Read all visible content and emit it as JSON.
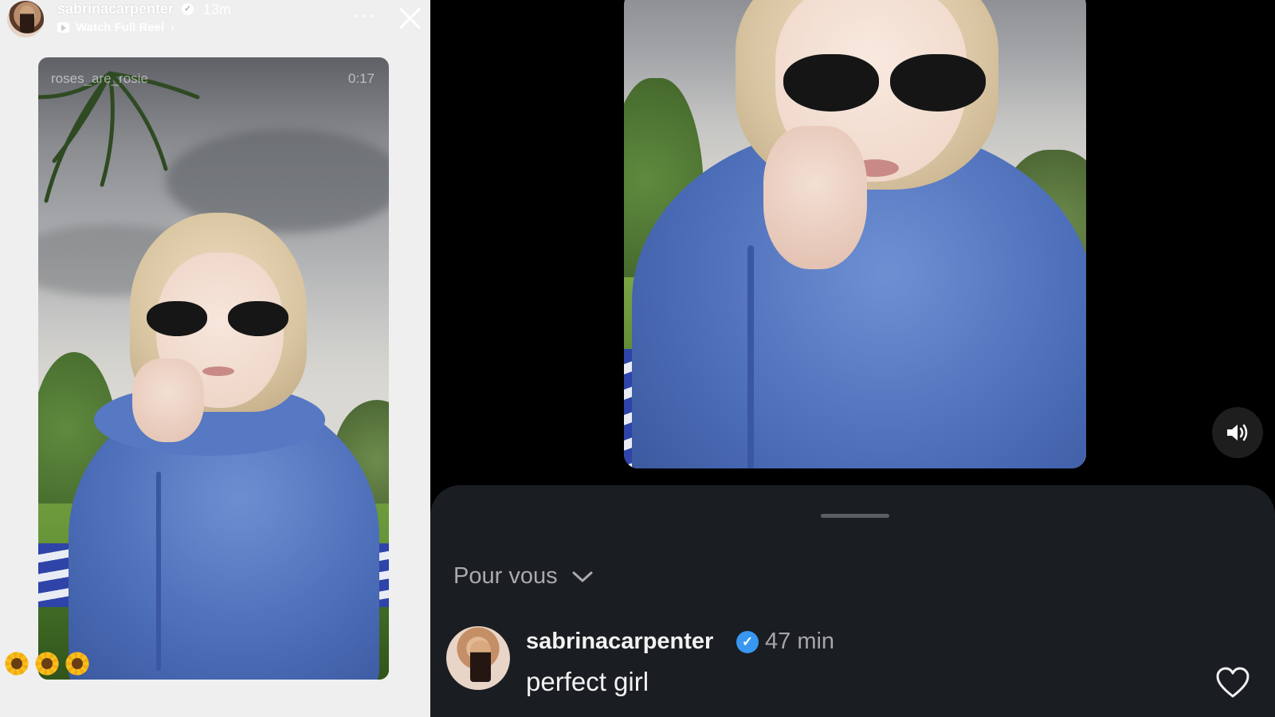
{
  "story": {
    "username": "sabrinacarpenter",
    "time": "13m",
    "reel_link_label": "Watch Full Reel",
    "audio_label": "roses_are_rosie",
    "duration": "0:17",
    "sticker_emoji": [
      "🌼",
      "🌼",
      "🌼"
    ]
  },
  "reel": {
    "volume_icon": "speaker-on-icon"
  },
  "comments": {
    "sort_label": "Pour vous",
    "items": [
      {
        "username": "sabrinacarpenter",
        "time": "47 min",
        "text": "perfect girl",
        "verified": true
      }
    ]
  },
  "colors": {
    "verified_blue": "#3897f0",
    "sheet_bg": "#1a1d21",
    "story_bg": "#efefef"
  }
}
